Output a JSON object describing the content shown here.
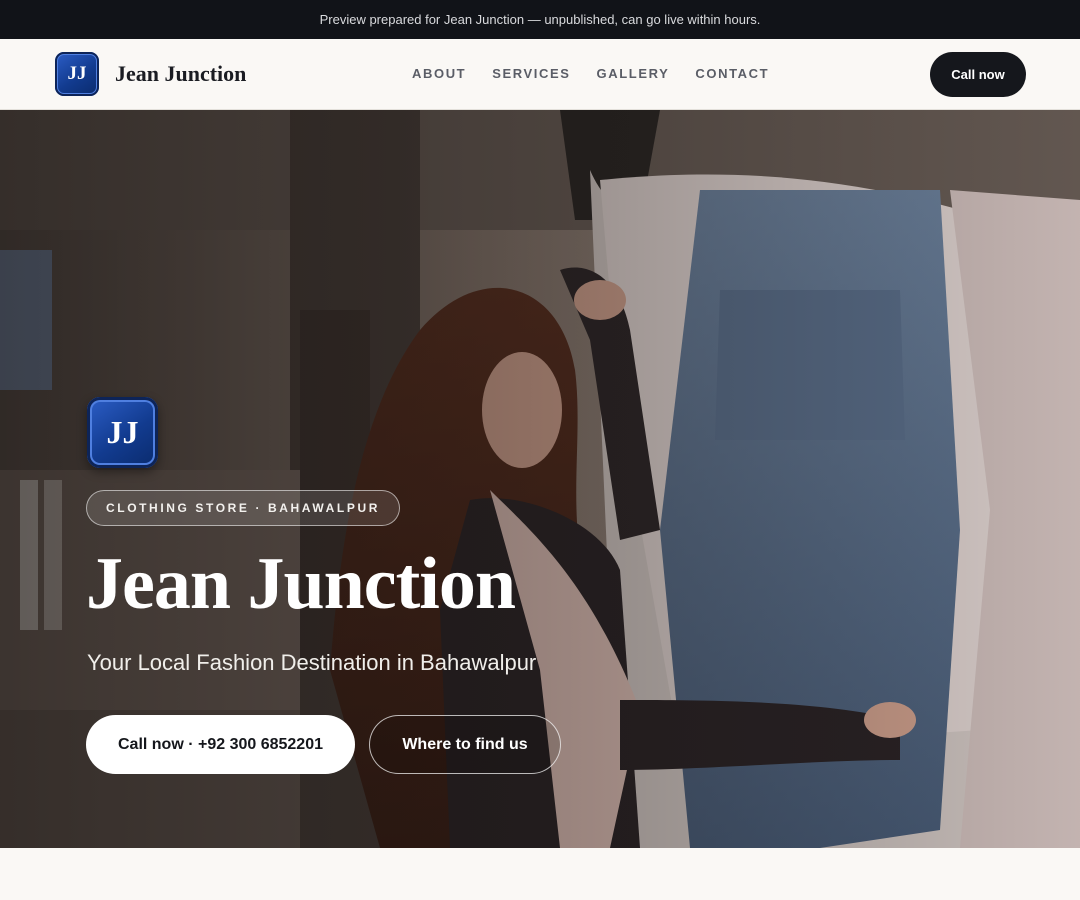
{
  "preview_banner": "Preview prepared for Jean Junction — unpublished, can go live within hours.",
  "header": {
    "logo_initials": "JJ",
    "brand_name": "Jean Junction",
    "nav": [
      {
        "label": "ABOUT"
      },
      {
        "label": "SERVICES"
      },
      {
        "label": "GALLERY"
      },
      {
        "label": "CONTACT"
      }
    ],
    "call_label": "Call now"
  },
  "hero": {
    "logo_initials": "JJ",
    "tag": "CLOTHING STORE · BAHAWALPUR",
    "title": "Jean Junction",
    "subtitle": "Your Local Fashion Destination in Bahawalpur",
    "primary_cta": "Call now · +92 300 6852201",
    "secondary_cta": "Where to find us"
  },
  "colors": {
    "topbar": "#111318",
    "logo_blue": "#123b8f",
    "dark_button": "#15171c",
    "page_bg": "#faf8f5"
  }
}
